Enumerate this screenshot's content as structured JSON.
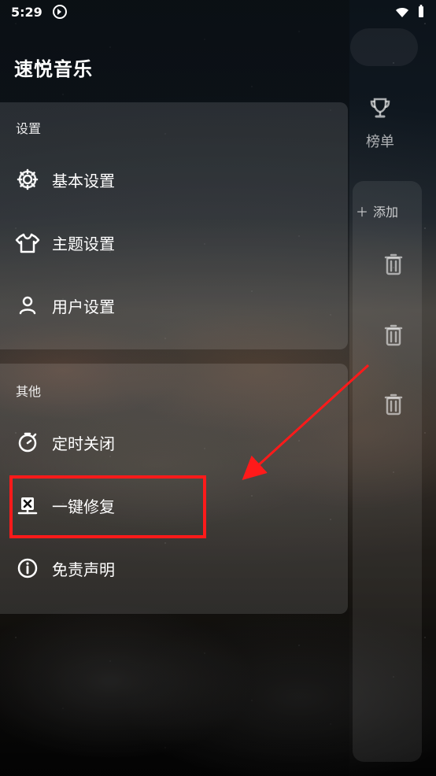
{
  "status": {
    "time": "5:29",
    "icons": [
      "app-indicator-icon",
      "wifi-icon",
      "battery-icon"
    ]
  },
  "drawer": {
    "app_title": "速悦音乐",
    "sections": {
      "settings": {
        "title": "设置",
        "items": [
          {
            "label": "基本设置",
            "icon": "gear-icon"
          },
          {
            "label": "主题设置",
            "icon": "shirt-icon"
          },
          {
            "label": "用户设置",
            "icon": "user-icon"
          }
        ]
      },
      "other": {
        "title": "其他",
        "items": [
          {
            "label": "定时关闭",
            "icon": "timer-icon"
          },
          {
            "label": "一键修复",
            "icon": "repair-icon"
          },
          {
            "label": "免责声明",
            "icon": "info-icon"
          }
        ]
      }
    }
  },
  "right_app": {
    "rank_label": "榜单",
    "add_label": "添加",
    "trash_icons": [
      "trash-icon",
      "trash-icon",
      "trash-icon"
    ]
  },
  "annotation": {
    "color": "#ff1a1a"
  }
}
